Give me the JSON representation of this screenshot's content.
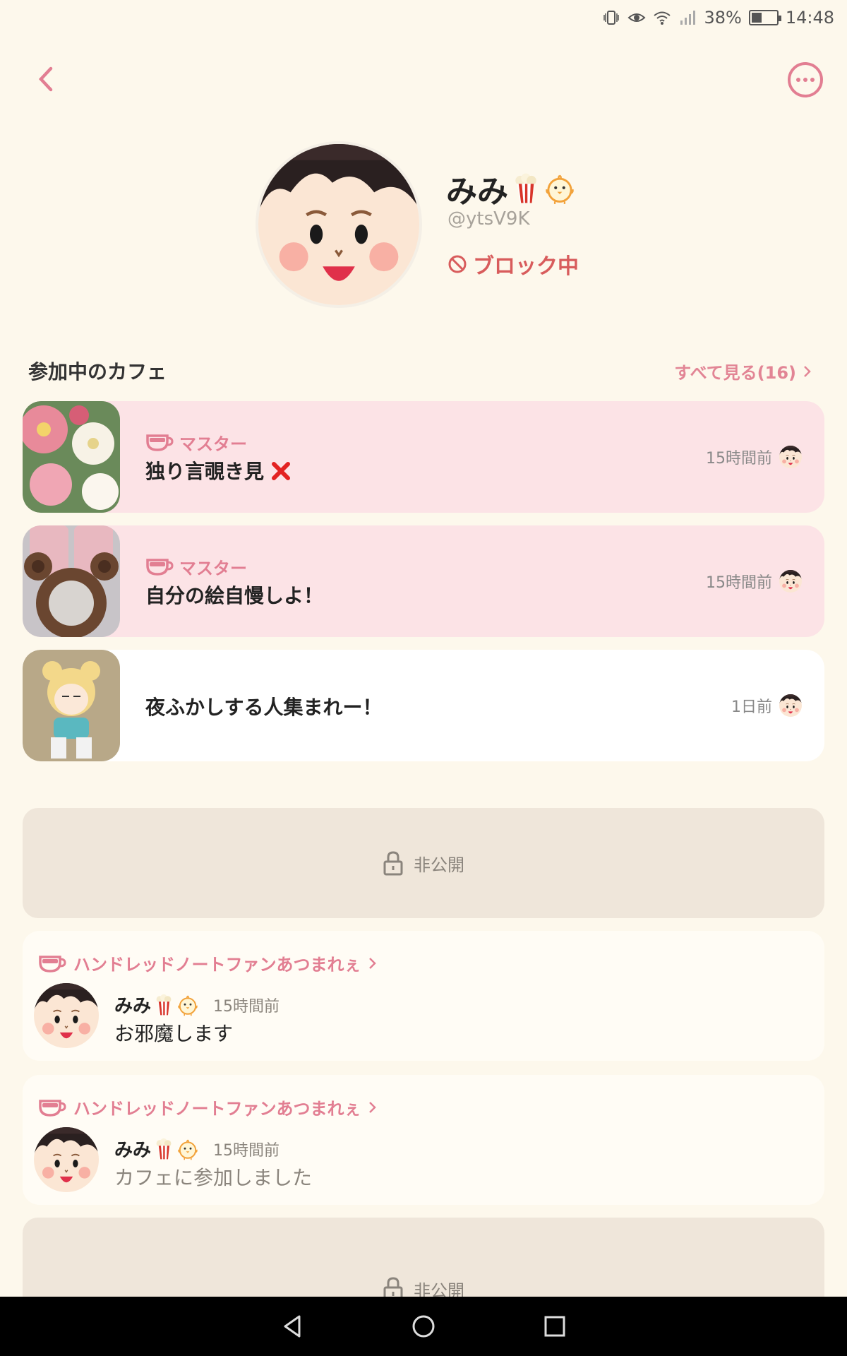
{
  "status": {
    "battery": "38%",
    "time": "14:48"
  },
  "profile": {
    "name": "みみ",
    "handle": "@ytsV9K",
    "blocked_label": "ブロック中"
  },
  "cafes_section": {
    "title": "参加中のカフェ",
    "see_all": "すべて見る(16)",
    "items": [
      {
        "role": "マスター",
        "name": "独り言覗き見",
        "time": "15時間前"
      },
      {
        "role": "マスター",
        "name": "自分の絵自慢しよ！",
        "time": "15時間前"
      },
      {
        "role": "",
        "name": "夜ふかしする人集まれー！",
        "time": "1日前"
      }
    ]
  },
  "private_label": "非公開",
  "activities": [
    {
      "cafe": "ハンドレッドノートファンあつまれぇ",
      "user": "みみ",
      "ago": "15時間前",
      "text": "お邪魔します"
    },
    {
      "cafe": "ハンドレッドノートファンあつまれぇ",
      "user": "みみ",
      "ago": "15時間前",
      "text": "カフェに参加しました"
    }
  ],
  "colors": {
    "accent": "#e27e92",
    "background": "#fdf8ec",
    "card_pink": "#fce3e6",
    "private_bg": "#efe6da",
    "blocked": "#d85c5c"
  }
}
